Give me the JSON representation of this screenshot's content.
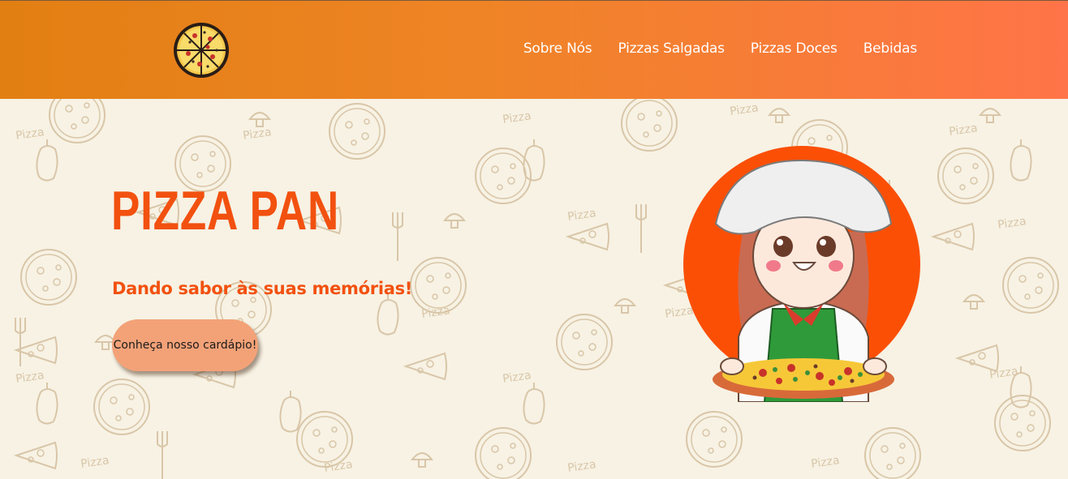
{
  "header": {
    "logo": "pizza-logo-icon",
    "nav": [
      {
        "label": "Sobre Nós"
      },
      {
        "label": "Pizzas Salgadas"
      },
      {
        "label": "Pizzas Doces"
      },
      {
        "label": "Bebidas"
      }
    ]
  },
  "hero": {
    "title": "PIZZA PAN",
    "tagline": "Dando sabor às suas memórias!",
    "cta_label": "Conheça nosso cardápio!",
    "illustration": "chef-girl-with-pizza",
    "pattern_word": "Pizza"
  },
  "colors": {
    "header_start": "#e27f12",
    "header_end": "#ff7448",
    "accent": "#f2510f",
    "background": "#f7f2e4",
    "cta": "#f3a278"
  }
}
